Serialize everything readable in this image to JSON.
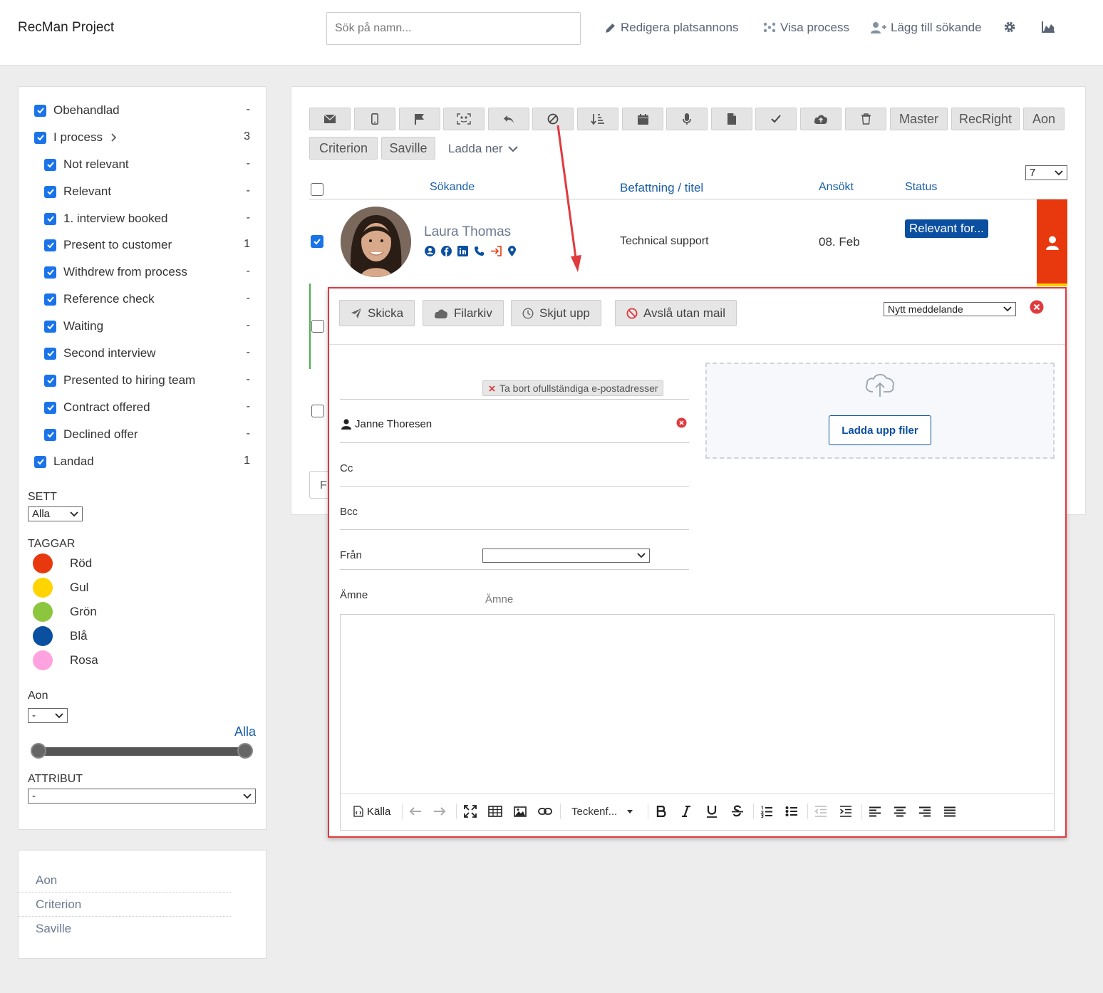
{
  "header": {
    "app_title": "RecMan Project",
    "search_placeholder": "Sök på namn...",
    "links": {
      "edit_ad": "Redigera platsannons",
      "show_process": "Visa process",
      "add_applicant": "Lägg till sökande"
    }
  },
  "filters": [
    {
      "label": "Obehandlad",
      "count": "-",
      "checked": true
    },
    {
      "label": "I process",
      "count": "3",
      "checked": true
    },
    {
      "label": "Not relevant",
      "count": "-",
      "checked": true
    },
    {
      "label": "Relevant",
      "count": "-",
      "checked": true
    },
    {
      "label": "1. interview booked",
      "count": "-",
      "checked": true
    },
    {
      "label": "Present to customer",
      "count": "1",
      "checked": true
    },
    {
      "label": "Withdrew from process",
      "count": "-",
      "checked": true
    },
    {
      "label": "Reference check",
      "count": "-",
      "checked": true
    },
    {
      "label": "Waiting",
      "count": "-",
      "checked": true
    },
    {
      "label": "Second interview",
      "count": "-",
      "checked": true
    },
    {
      "label": "Presented to hiring team",
      "count": "-",
      "checked": true
    },
    {
      "label": "Contract offered",
      "count": "-",
      "checked": true
    },
    {
      "label": "Declined offer",
      "count": "-",
      "checked": true
    },
    {
      "label": "Landad",
      "count": "1",
      "checked": true
    }
  ],
  "sett": {
    "label": "SETT",
    "value": "Alla"
  },
  "taggar": {
    "label": "TAGGAR",
    "items": [
      {
        "label": "Röd",
        "color": "#e8380d"
      },
      {
        "label": "Gul",
        "color": "#ffd400"
      },
      {
        "label": "Grön",
        "color": "#8cc63f"
      },
      {
        "label": "Blå",
        "color": "#0a4fa0"
      },
      {
        "label": "Rosa",
        "color": "#ffa3e0"
      }
    ]
  },
  "aon": {
    "label": "Aon",
    "value": "-",
    "range_label": "Alla"
  },
  "attribut": {
    "label": "ATTRIBUT",
    "value": "-"
  },
  "bottom_links": [
    "Aon",
    "Criterion",
    "Saville"
  ],
  "toolbar": {
    "text_buttons": [
      "Master",
      "RecRight",
      "Aon",
      "Criterion",
      "Saville"
    ],
    "download": "Ladda ner",
    "page_size": "7"
  },
  "table": {
    "headers": {
      "applicant": "Sökande",
      "position": "Befattning / titel",
      "applied": "Ansökt",
      "status": "Status"
    },
    "row": {
      "name": "Laura Thomas",
      "position": "Technical support",
      "applied": "08. Feb",
      "status": "Relevant for..."
    },
    "footer_fragment": "F"
  },
  "email": {
    "buttons": {
      "send": "Skicka",
      "archive": "Filarkiv",
      "postpone": "Skjut upp",
      "reject": "Avslå utan mail"
    },
    "template_value": "Nytt meddelande",
    "remove_incomplete": "Ta bort ofullständiga e-postadresser",
    "recipient": "Janne Thoresen",
    "cc_label": "Cc",
    "bcc_label": "Bcc",
    "from_label": "Från",
    "subject_label": "Ämne",
    "subject_placeholder": "Ämne",
    "upload": "Ladda upp filer",
    "editor": {
      "source": "Källa",
      "font": "Teckenf..."
    }
  },
  "colors": {
    "accent": "#1a73e8",
    "status_badge": "#0b4fa0",
    "red_tab": "#e8380d",
    "highlight_border": "#e03a3e"
  }
}
